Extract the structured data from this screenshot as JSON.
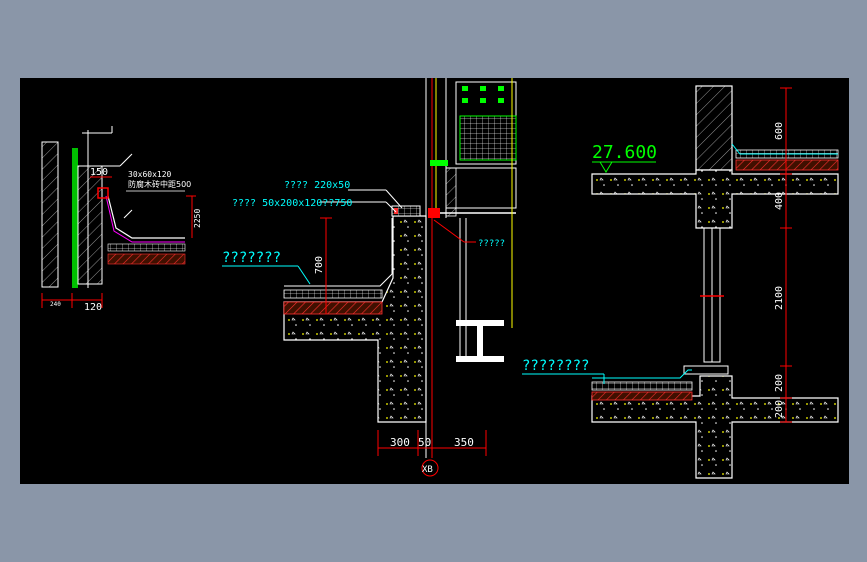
{
  "colors": {
    "background": "#8a96a8",
    "canvas": "#000000",
    "wall": "#ffffff",
    "dimension": "#ff0000",
    "text_cyan": "#00ffff",
    "text_yellow": "#ffff00",
    "text_green": "#00ff00",
    "hatch_red": "#ff3030",
    "hatch_white": "#d0d0d0",
    "insulation": "#c06000"
  },
  "left_detail": {
    "dim_150": "150",
    "note_1": "30x60x120",
    "note_2": "防腐木砖中距500",
    "dim_side": "2250",
    "dim_bottom_1": "240",
    "dim_bottom_2": "120"
  },
  "middle_detail": {
    "label_1": "???? 220x50",
    "label_2": "???? 50x200x120??750",
    "label_3": "?????",
    "title": "???????",
    "dim_700": "700",
    "dim_300": "300",
    "dim_50": "50",
    "dim_350": "350",
    "axis": "XB"
  },
  "right_detail": {
    "elevation": "27.600",
    "title": "????????",
    "dim_600": "600",
    "dim_400": "400",
    "dim_2100": "2100",
    "dim_200a": "200",
    "dim_200b": "200"
  }
}
